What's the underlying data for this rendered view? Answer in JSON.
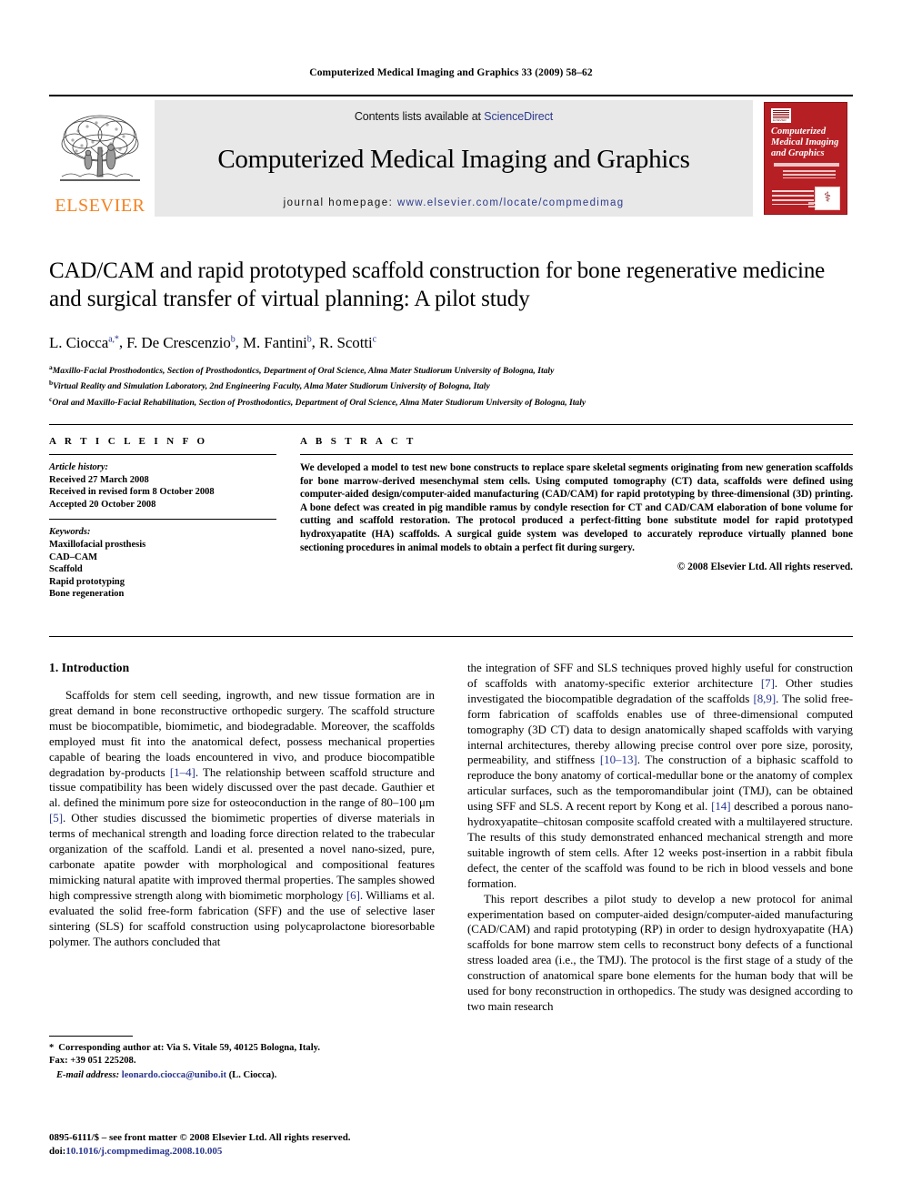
{
  "running_head": "Computerized Medical Imaging and Graphics 33 (2009) 58–62",
  "masthead": {
    "publisher_logo_text": "ELSEVIER",
    "contents_prefix": "Contents lists available at",
    "contents_link": "ScienceDirect",
    "journal_title": "Computerized Medical Imaging and Graphics",
    "homepage_label": "journal homepage:",
    "homepage_url": "www.elsevier.com/locate/compmedimag",
    "cover": {
      "title_line1": "Computerized",
      "title_line2": "Medical Imaging",
      "title_line3": "and Graphics",
      "seal_glyph": "⚕"
    },
    "colors": {
      "elsevier_orange": "#F58220",
      "banner_grey": "#e8e8e8",
      "link_blue": "#2B3A8C",
      "cover_red": "#B62025"
    }
  },
  "article": {
    "title": "CAD/CAM and rapid prototyped scaffold construction for bone regenerative medicine and surgical transfer of virtual planning: A pilot study",
    "authors": [
      {
        "name": "L. Ciocca",
        "marks": "a,*"
      },
      {
        "name": "F. De Crescenzio",
        "marks": "b"
      },
      {
        "name": "M. Fantini",
        "marks": "b"
      },
      {
        "name": "R. Scotti",
        "marks": "c"
      }
    ],
    "affiliations": [
      {
        "mark": "a",
        "text": "Maxillo-Facial Prosthodontics, Section of Prosthodontics, Department of Oral Science, Alma Mater Studiorum University of Bologna, Italy"
      },
      {
        "mark": "b",
        "text": "Virtual Reality and Simulation Laboratory, 2nd Engineering Faculty, Alma Mater Studiorum University of Bologna, Italy"
      },
      {
        "mark": "c",
        "text": "Oral and Maxillo-Facial Rehabilitation, Section of Prosthodontics, Department of Oral Science, Alma Mater Studiorum University of Bologna, Italy"
      }
    ]
  },
  "article_info": {
    "heading": "A R T I C L E   I N F O",
    "history_label": "Article history:",
    "history": [
      "Received 27 March 2008",
      "Received in revised form 8 October 2008",
      "Accepted 20 October 2008"
    ],
    "keywords_label": "Keywords:",
    "keywords": [
      "Maxillofacial prosthesis",
      "CAD–CAM",
      "Scaffold",
      "Rapid prototyping",
      "Bone regeneration"
    ]
  },
  "abstract": {
    "heading": "A B S T R A C T",
    "text": "We developed a model to test new bone constructs to replace spare skeletal segments originating from new generation scaffolds for bone marrow-derived mesenchymal stem cells. Using computed tomography (CT) data, scaffolds were defined using computer-aided design/computer-aided manufacturing (CAD/CAM) for rapid prototyping by three-dimensional (3D) printing. A bone defect was created in pig mandible ramus by condyle resection for CT and CAD/CAM elaboration of bone volume for cutting and scaffold restoration. The protocol produced a perfect-fitting bone substitute model for rapid prototyped hydroxyapatite (HA) scaffolds. A surgical guide system was developed to accurately reproduce virtually planned bone sectioning procedures in animal models to obtain a perfect fit during surgery.",
    "copyright": "© 2008 Elsevier Ltd. All rights reserved."
  },
  "body": {
    "section_number_title": "1. Introduction",
    "left_paragraph_1_part1": "Scaffolds for stem cell seeding, ingrowth, and new tissue formation are in great demand in bone reconstructive orthopedic surgery. The scaffold structure must be biocompatible, biomimetic, and biodegradable. Moreover, the scaffolds employed must fit into the anatomical defect, possess mechanical properties capable of bearing the loads encountered in vivo, and produce biocompatible degradation by-products ",
    "ref_1_4": "[1–4]",
    "left_paragraph_1_part2": ". The relationship between scaffold structure and tissue compatibility has been widely discussed over the past decade. Gauthier et al. defined the minimum pore size for osteoconduction in the range of 80–100 μm ",
    "ref_5": "[5]",
    "left_paragraph_1_part3": ". Other studies discussed the biomimetic properties of diverse materials in terms of mechanical strength and loading force direction related to the trabecular organization of the scaffold. Landi et al. presented a novel nano-sized, pure, carbonate apatite powder with morphological and compositional features mimicking natural apatite with improved thermal properties. The samples showed high compressive strength along with biomimetic morphology ",
    "ref_6": "[6]",
    "left_paragraph_1_part4": ". Williams et al. evaluated the solid free-form fabrication (SFF) and the use of selective laser sintering (SLS) for scaffold construction using polycaprolactone bioresorbable polymer. The authors concluded that",
    "right_paragraph_1_part1": "the integration of SFF and SLS techniques proved highly useful for construction of scaffolds with anatomy-specific exterior architecture ",
    "ref_7": "[7]",
    "right_paragraph_1_part2": ". Other studies investigated the biocompatible degradation of the scaffolds ",
    "ref_8_9": "[8,9]",
    "right_paragraph_1_part3": ". The solid free-form fabrication of scaffolds enables use of three-dimensional computed tomography (3D CT) data to design anatomically shaped scaffolds with varying internal architectures, thereby allowing precise control over pore size, porosity, permeability, and stiffness ",
    "ref_10_13": "[10–13]",
    "right_paragraph_1_part4": ". The construction of a biphasic scaffold to reproduce the bony anatomy of cortical-medullar bone or the anatomy of complex articular surfaces, such as the temporomandibular joint (TMJ), can be obtained using SFF and SLS. A recent report by Kong et al. ",
    "ref_14": "[14]",
    "right_paragraph_1_part5": " described a porous nano-hydroxyapatite–chitosan composite scaffold created with a multilayered structure. The results of this study demonstrated enhanced mechanical strength and more suitable ingrowth of stem cells. After 12 weeks post-insertion in a rabbit fibula defect, the center of the scaffold was found to be rich in blood vessels and bone formation.",
    "right_paragraph_2": "This report describes a pilot study to develop a new protocol for animal experimentation based on computer-aided design/computer-aided manufacturing (CAD/CAM) and rapid prototyping (RP) in order to design hydroxyapatite (HA) scaffolds for bone marrow stem cells to reconstruct bony defects of a functional stress loaded area (i.e., the TMJ). The protocol is the first stage of a study of the construction of anatomical spare bone elements for the human body that will be used for bony reconstruction in orthopedics. The study was designed according to two main research"
  },
  "footnote": {
    "star": "*",
    "corresponding": "Corresponding author at: Via S. Vitale 59, 40125 Bologna, Italy.",
    "fax": "Fax: +39 051 225208.",
    "email_label": "E-mail address:",
    "email_address": "leonardo.ciocca@unibo.it",
    "email_owner": "(L. Ciocca)."
  },
  "page_footer": {
    "issn_line": "0895-6111/$ – see front matter © 2008 Elsevier Ltd. All rights reserved.",
    "doi_label": "doi:",
    "doi_value": "10.1016/j.compmedimag.2008.10.005"
  }
}
